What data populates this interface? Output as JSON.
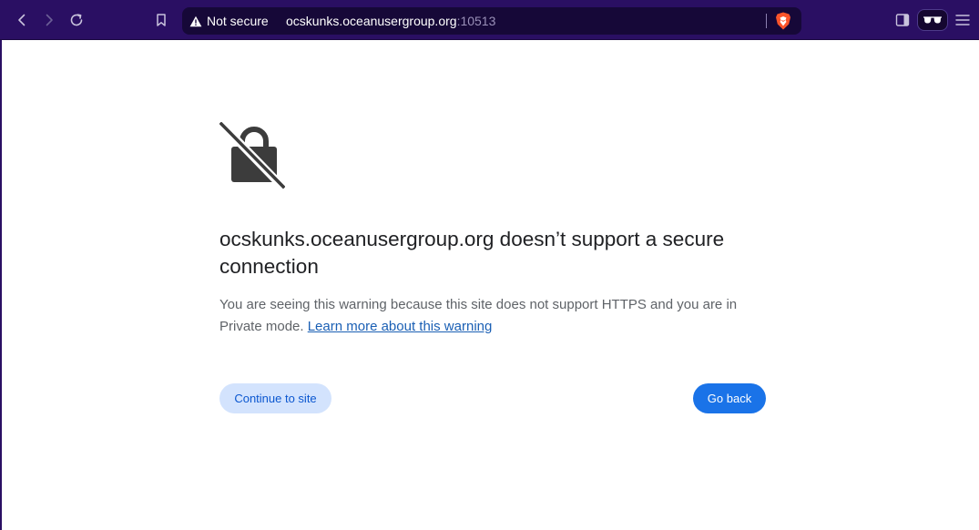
{
  "toolbar": {
    "back_icon": "chevron-left-icon",
    "forward_icon": "chevron-right-icon",
    "reload_icon": "reload-icon",
    "bookmark_icon": "bookmark-icon",
    "sidebar_icon": "sidebar-icon",
    "private_icon": "incognito-glasses-icon",
    "menu_icon": "hamburger-menu-icon"
  },
  "omnibox": {
    "security_label": "Not secure",
    "url_host": "ocskunks.oceanusergroup.org",
    "url_port": ":10513",
    "shield_icon": "brave-shield-icon"
  },
  "interstitial": {
    "heading": "ocskunks.oceanusergroup.org doesn’t support a secure connection",
    "explanation": "You are seeing this warning because this site does not support HTTPS and you are in Private mode. ",
    "learn_more_link": "Learn more about this warning",
    "continue_button": "Continue to site",
    "back_button": "Go back"
  },
  "colors": {
    "toolbar_bg": "#2a0f63",
    "omnibox_bg": "#160838",
    "primary_button": "#1a73e8",
    "secondary_button": "#d3e3fd",
    "link": "#1a5fb4"
  }
}
